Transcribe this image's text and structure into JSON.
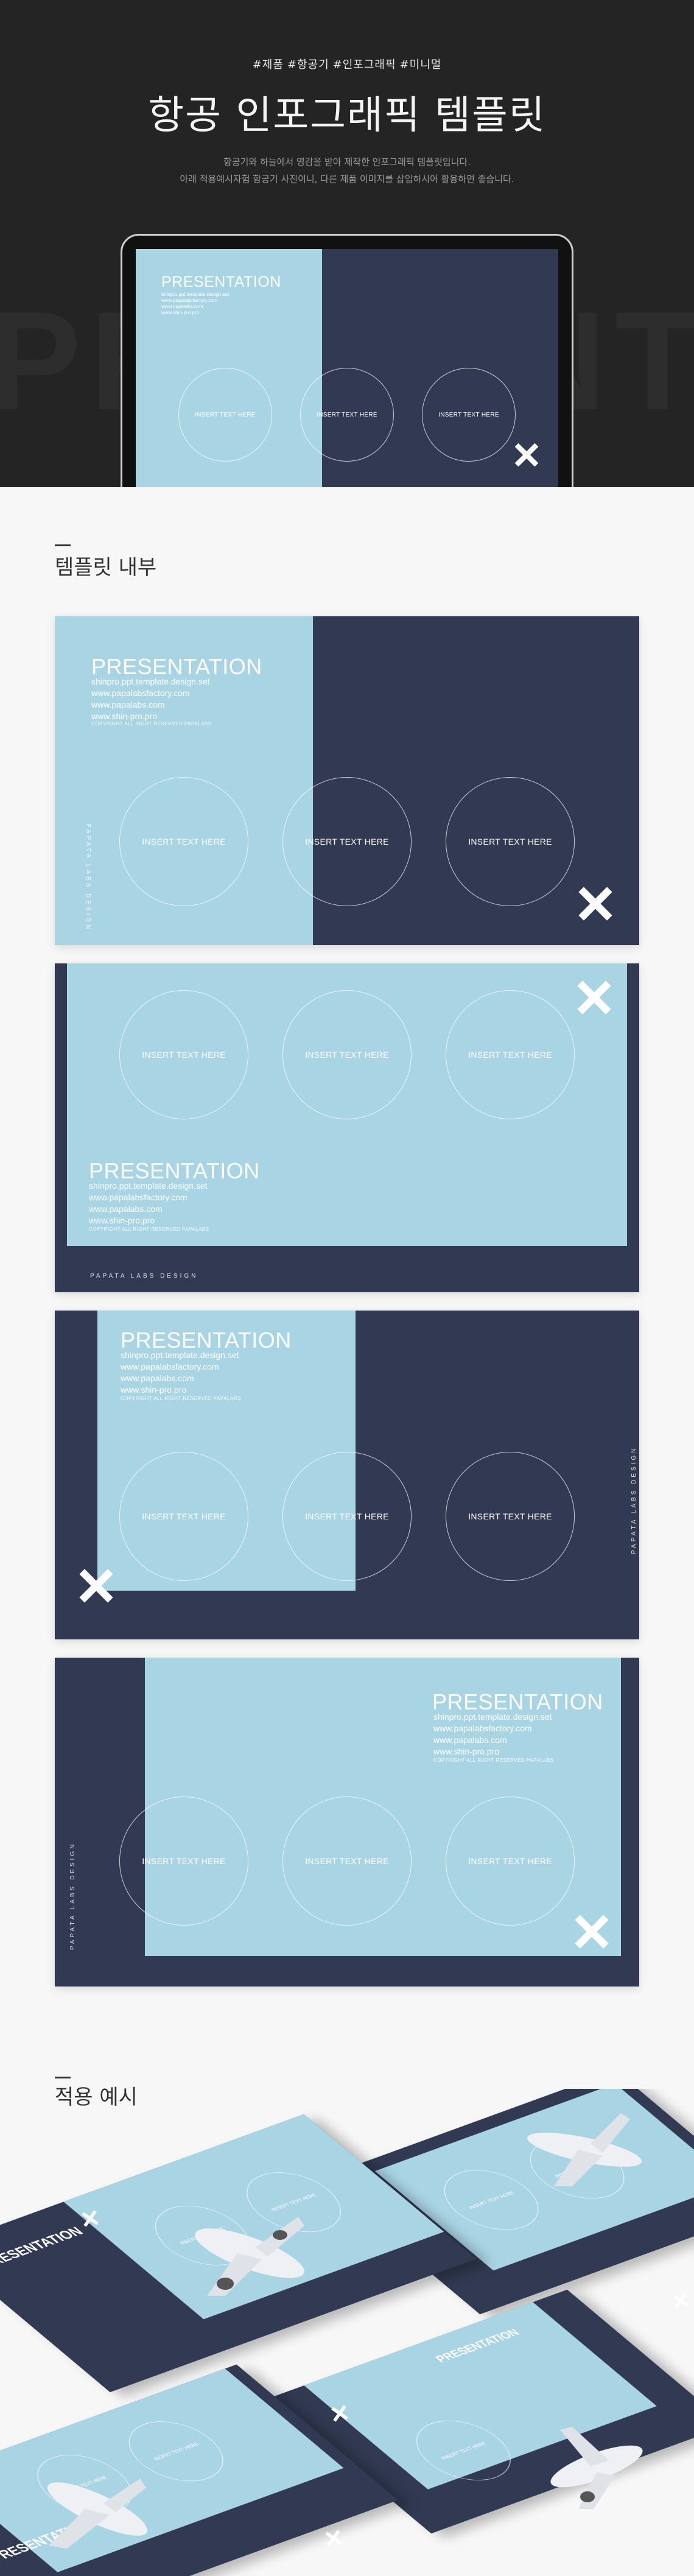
{
  "hero": {
    "tags": [
      "#제품",
      "#항공기",
      "#인포그래픽",
      "#미니멀"
    ],
    "title": "항공 인포그래픽 템플릿",
    "desc_line1": "항공기와 하늘에서 영감을 받아 제작한 인포그래픽 템플릿입니다.",
    "desc_line2": "아래 적용예시자험 항공기 사진이니, 다른 제품 이미지를 삽입하시어 활용하면 좋습니다.",
    "bg_text": "PRESENTATA"
  },
  "section_inside": {
    "title": "템플릿 내부"
  },
  "section_examples": {
    "title": "적용 예시"
  },
  "slide": {
    "title": "PRESENTATION",
    "line1": "shinpro.ppt.template.design.set",
    "line2": "www.papalabsfactory.com",
    "line3": "www.papalabs.com",
    "line4": "www.shin-pro.pro",
    "note": "COPYRIGHT ALL RIGHT RESERVED PAPALABS",
    "circle_text": "INSERT TEXT HERE",
    "brand": "PAPATA LABS DESIGN"
  },
  "colors": {
    "navy": "#313a52",
    "light_blue": "#a9d4e4",
    "hero_bg": "#242424",
    "page_bg": "#f7f7f7"
  }
}
